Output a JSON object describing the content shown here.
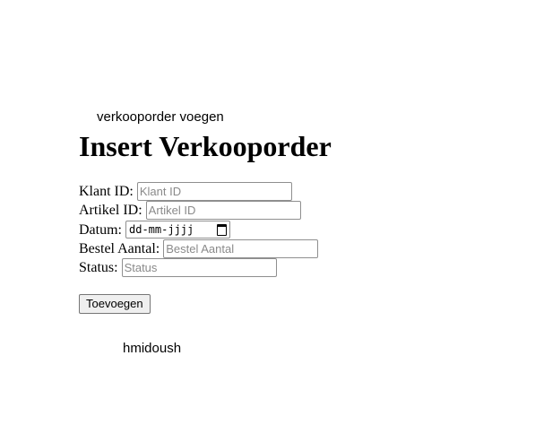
{
  "header": {
    "nav_link": "verkooporder voegen",
    "title": "Insert Verkooporder"
  },
  "form": {
    "fields": [
      {
        "label": "Klant ID:",
        "placeholder": "Klant ID",
        "value": ""
      },
      {
        "label": "Artikel ID:",
        "placeholder": "Artikel ID",
        "value": ""
      },
      {
        "label": "Datum:",
        "value": "dd-mm-jjjj"
      },
      {
        "label": "Bestel Aantal:",
        "placeholder": "Bestel Aantal",
        "value": ""
      },
      {
        "label": "Status:",
        "placeholder": "Status",
        "value": ""
      }
    ],
    "submit_label": "Toevoegen"
  },
  "footer": {
    "username": "hmidoush"
  }
}
